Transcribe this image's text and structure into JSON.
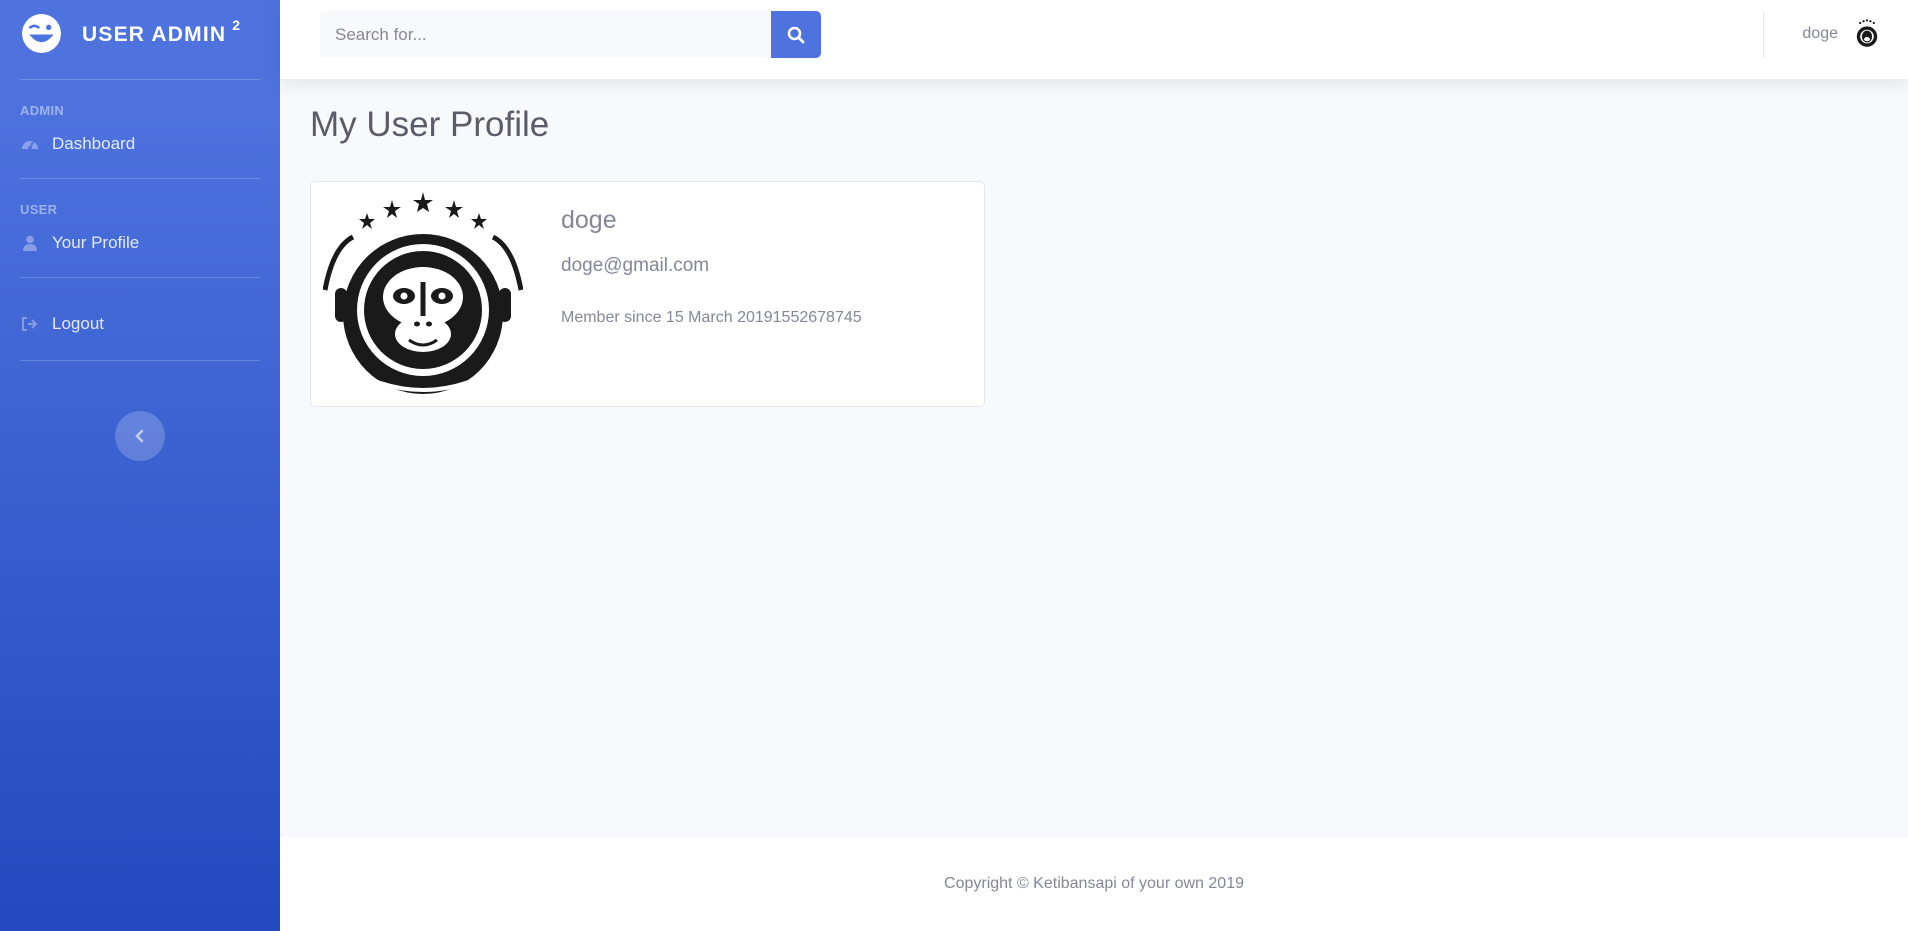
{
  "sidebar": {
    "brand": {
      "title": "USER ADMIN",
      "superscript": "2"
    },
    "sections": [
      {
        "heading": "ADMIN",
        "items": [
          {
            "label": "Dashboard",
            "icon": "tachometer-icon"
          }
        ]
      },
      {
        "heading": "USER",
        "items": [
          {
            "label": "Your Profile",
            "icon": "user-icon"
          }
        ]
      }
    ],
    "logout": {
      "label": "Logout",
      "icon": "sign-out-icon"
    },
    "toggle_icon": "chevron-left-icon"
  },
  "topbar": {
    "search": {
      "placeholder": "Search for...",
      "value": "",
      "icon": "search-icon"
    },
    "user": {
      "name": "doge",
      "avatar_icon": "astronaut-monkey-avatar"
    }
  },
  "main": {
    "page_title": "My User Profile",
    "profile": {
      "name": "doge",
      "email": "doge@gmail.com",
      "member_since": "Member since 15 March 20191552678745"
    }
  },
  "footer": {
    "copyright": "Copyright © Ketibansapi of your own 2019"
  },
  "colors": {
    "primary": "#4e73df",
    "primary_dark": "#224abe",
    "text": "#858796",
    "title": "#5a5c69",
    "background": "#f8f9fc"
  }
}
